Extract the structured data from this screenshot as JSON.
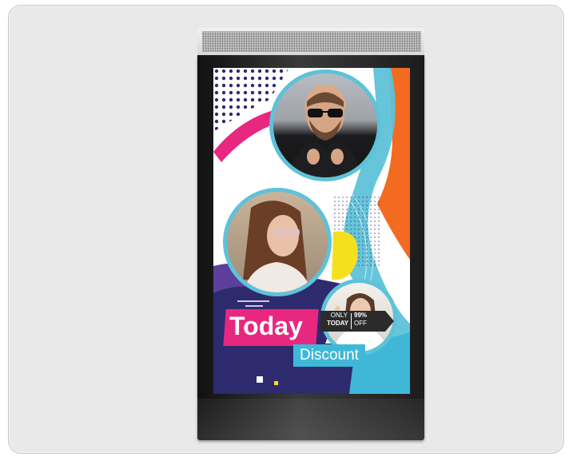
{
  "poster": {
    "headline": "Today",
    "subline": "Discount",
    "promo_only": "ONLY",
    "promo_today": "TODAY",
    "promo_percent": "99%",
    "promo_off": "OFF"
  },
  "colors": {
    "card_background": "#e9e9e9",
    "kiosk_frame": "#1c1c1c",
    "pink": "#e8277f",
    "cyan": "#3fb8d8",
    "orange": "#f26b21",
    "navy": "#2e2a6e",
    "yellow": "#f5e020",
    "purple": "#5b3f9a"
  },
  "icons": [
    "speaker-grille-icon"
  ]
}
